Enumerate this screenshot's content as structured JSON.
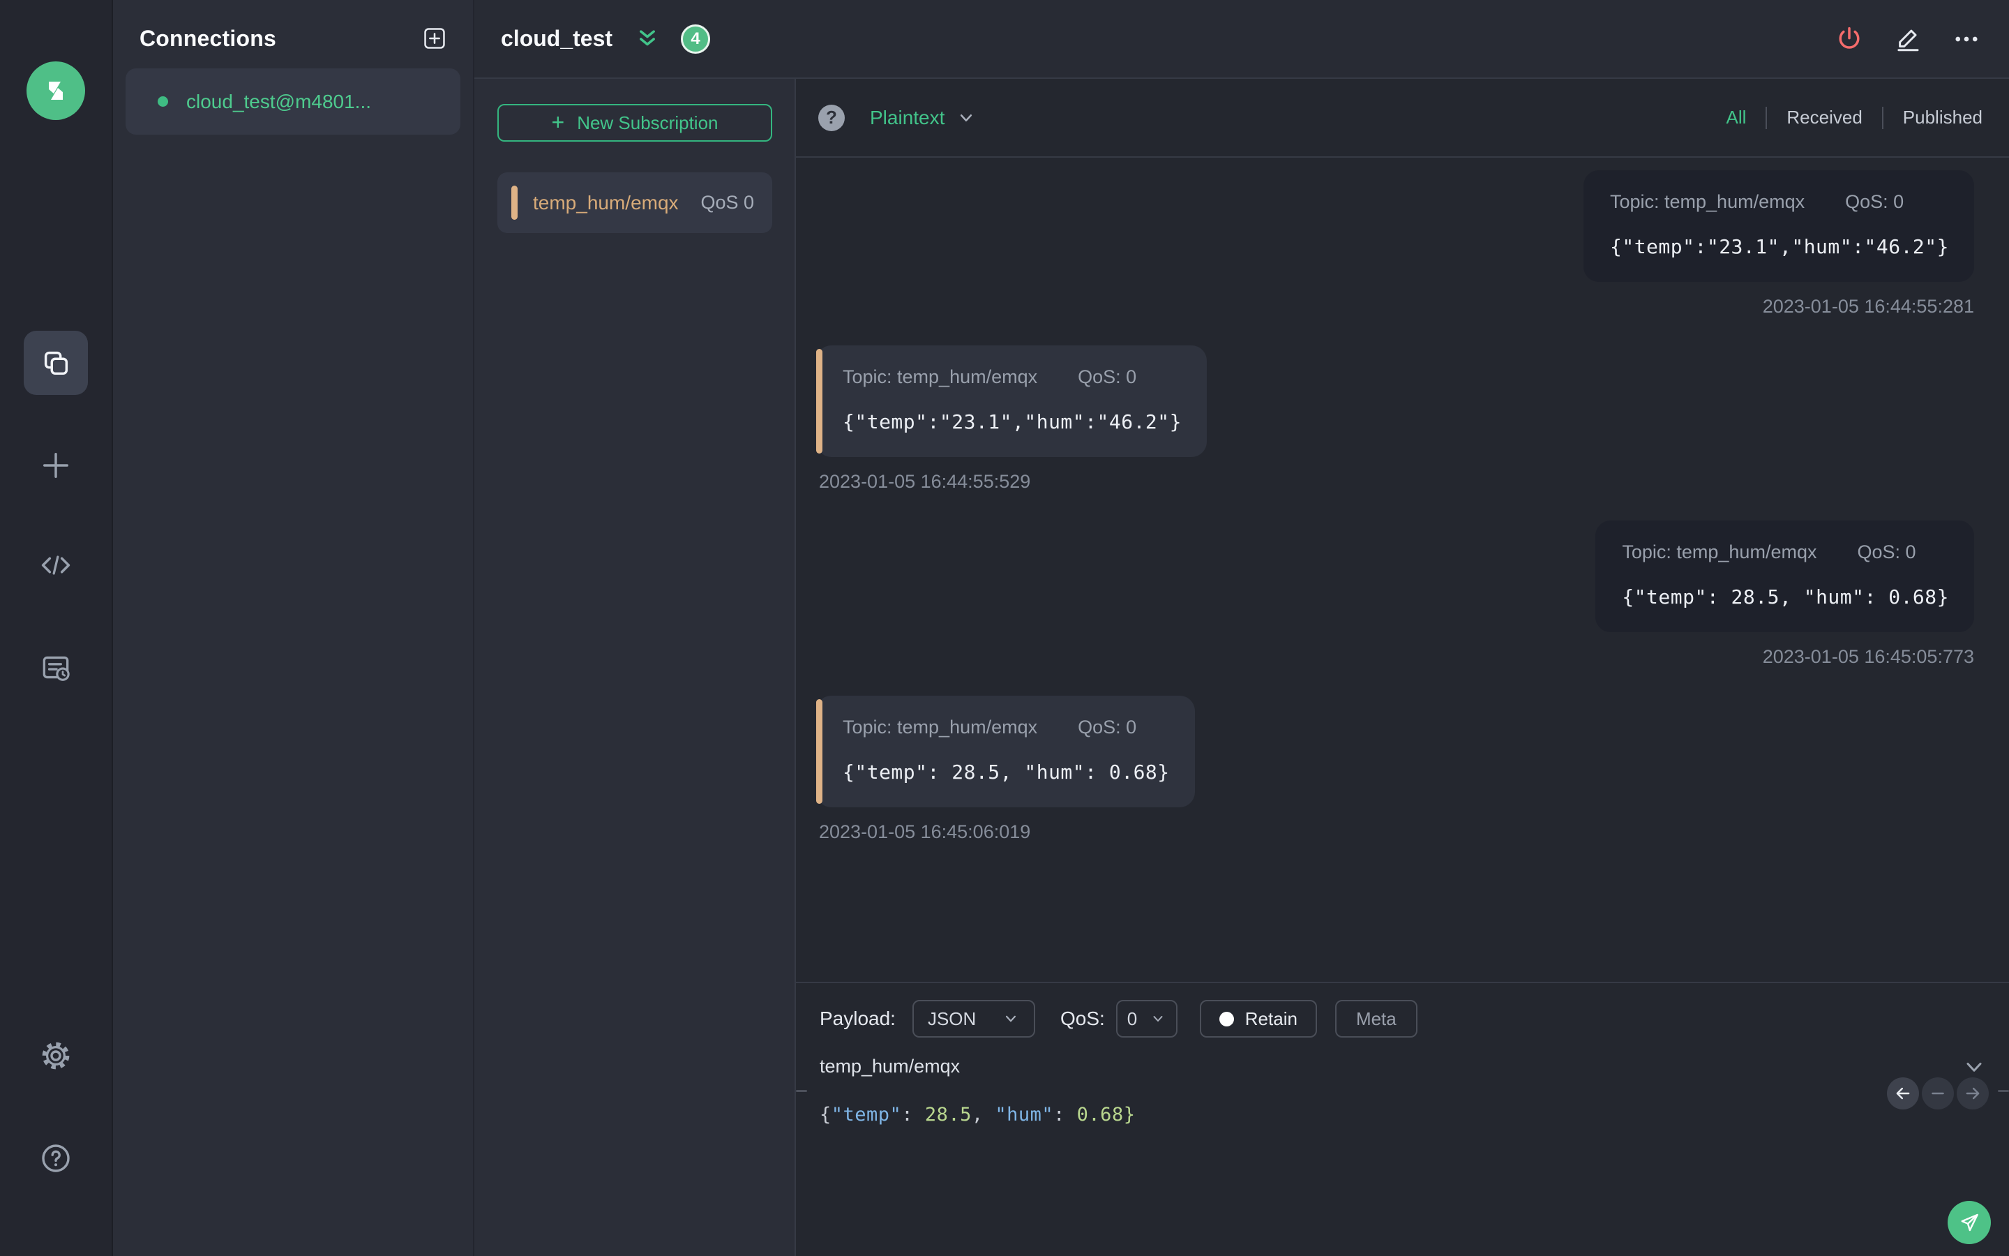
{
  "theme": {
    "accent_green": "#42c48a",
    "danger_red": "#f56c6c",
    "subscription_tan": "#dfb387",
    "bg_main": "#24272f",
    "bg_panel": "#2b2e38"
  },
  "icons": {
    "help_glyph": "?",
    "plus_glyph": "+"
  },
  "sidebar": {
    "items": [
      {
        "name": "connections",
        "icon": "overlapping-squares-icon",
        "active": true
      },
      {
        "name": "new-connection",
        "icon": "plus-icon",
        "active": false
      },
      {
        "name": "script",
        "icon": "code-icon",
        "active": false
      },
      {
        "name": "log",
        "icon": "log-file-icon",
        "active": false
      },
      {
        "name": "settings",
        "icon": "gear-icon",
        "active": false
      },
      {
        "name": "help",
        "icon": "question-circle-icon",
        "active": false
      }
    ]
  },
  "connections": {
    "title": "Connections",
    "items": [
      {
        "name": "cloud_test@m4801...",
        "status": "connected"
      }
    ]
  },
  "header": {
    "title": "cloud_test",
    "badge_count": "4",
    "actions": [
      {
        "name": "disconnect",
        "icon": "power-icon"
      },
      {
        "name": "edit",
        "icon": "pencil-icon"
      },
      {
        "name": "more",
        "icon": "ellipsis-icon"
      }
    ]
  },
  "subscriptions": {
    "new_button_label": "New Subscription",
    "items": [
      {
        "topic": "temp_hum/emqx",
        "qos_label": "QoS 0"
      }
    ]
  },
  "messages": {
    "format_selector": {
      "value": "Plaintext"
    },
    "filters": [
      {
        "label": "All",
        "active": true
      },
      {
        "label": "Received",
        "active": false
      },
      {
        "label": "Published",
        "active": false
      }
    ],
    "items": [
      {
        "side": "right",
        "topic_label": "Topic: temp_hum/emqx",
        "qos_label": "QoS: 0",
        "payload": "{\"temp\":\"23.1\",\"hum\":\"46.2\"}",
        "timestamp": "2023-01-05 16:44:55:281"
      },
      {
        "side": "left",
        "topic_label": "Topic: temp_hum/emqx",
        "qos_label": "QoS: 0",
        "payload": "{\"temp\":\"23.1\",\"hum\":\"46.2\"}",
        "timestamp": "2023-01-05 16:44:55:529"
      },
      {
        "side": "right",
        "topic_label": "Topic: temp_hum/emqx",
        "qos_label": "QoS: 0",
        "payload": "{\"temp\": 28.5, \"hum\": 0.68}",
        "timestamp": "2023-01-05 16:45:05:773"
      },
      {
        "side": "left",
        "topic_label": "Topic: temp_hum/emqx",
        "qos_label": "QoS: 0",
        "payload": "{\"temp\": 28.5, \"hum\": 0.68}",
        "timestamp": "2023-01-05 16:45:06:019"
      }
    ]
  },
  "publish": {
    "payload_label": "Payload:",
    "format_value": "JSON",
    "qos_label": "QoS:",
    "qos_value": "0",
    "retain_label": "Retain",
    "meta_label": "Meta",
    "topic_value": "temp_hum/emqx",
    "editor_tokens": [
      {
        "t": "{",
        "c": "punct"
      },
      {
        "t": "\"temp\"",
        "c": "key"
      },
      {
        "t": ": ",
        "c": "punct"
      },
      {
        "t": "28.5",
        "c": "num"
      },
      {
        "t": ", ",
        "c": "punct"
      },
      {
        "t": "\"hum\"",
        "c": "key"
      },
      {
        "t": ": ",
        "c": "punct"
      },
      {
        "t": "0.68",
        "c": "num"
      },
      {
        "t": "}",
        "c": "num"
      }
    ]
  }
}
